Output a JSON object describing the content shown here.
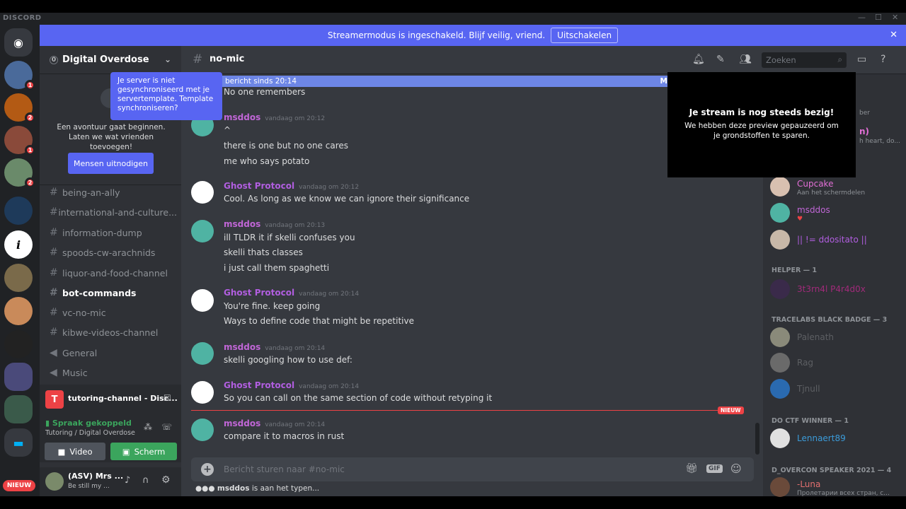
{
  "app": {
    "brand": "DISCORD"
  },
  "banner": {
    "text": "Streamermodus is ingeschakeld. Blijf veilig, vriend.",
    "button": "Uitschakelen"
  },
  "server": {
    "name": "Digital Overdose",
    "boost": "0"
  },
  "rail": {
    "badges": [
      "1",
      "2",
      "1",
      "2"
    ],
    "new_label": "NIEUW"
  },
  "tooltip": "Je server is niet gesynchroniseerd met je servertemplate. Template synchroniseren?",
  "welcome": {
    "line1": "Een avontuur gaat beginnen.",
    "line2": "Laten we wat vrienden toevoegen!",
    "button": "Mensen uitnodigen"
  },
  "channels": [
    {
      "name": "being-an-ally",
      "type": "text"
    },
    {
      "name": "international-and-culture...",
      "type": "text"
    },
    {
      "name": "information-dump",
      "type": "text"
    },
    {
      "name": "spoods-cw-arachnids",
      "type": "text"
    },
    {
      "name": "liquor-and-food-channel",
      "type": "text"
    },
    {
      "name": "bot-commands",
      "type": "text",
      "active": true
    },
    {
      "name": "vc-no-mic",
      "type": "text"
    },
    {
      "name": "kibwe-videos-channel",
      "type": "text"
    },
    {
      "name": "General",
      "type": "voice"
    },
    {
      "name": "Music",
      "type": "voice"
    }
  ],
  "voice": {
    "stream_title": "tutoring-channel - Disc...",
    "status": "Spraak gekoppeld",
    "location": "Tutoring / Digital Overdose",
    "video": "Video",
    "screen": "Scherm"
  },
  "user": {
    "name": "(ASV) Mrs ...",
    "status": "Be still my ..."
  },
  "chat": {
    "channel": "no-mic",
    "search_placeholder": "Zoeken",
    "new_since": "bericht sinds 20:14",
    "new_since_right": "Ma",
    "first_line": "No one remembers",
    "messages": [
      {
        "author": "msddos",
        "color": "#c066d6",
        "time": "vandaag om 20:12",
        "lines": [
          "^",
          "there is one but no one cares",
          "me who says potato"
        ]
      },
      {
        "author": "Ghost Protocol",
        "color": "#b15ee0",
        "time": "vandaag om 20:12",
        "lines": [
          "Cool. As long as we know we can ignore their significance"
        ]
      },
      {
        "author": "msddos",
        "color": "#c066d6",
        "time": "vandaag om 20:13",
        "lines": [
          "ill TLDR it if skelli confuses you",
          "skelli thats classes",
          "i just call them spaghetti"
        ]
      },
      {
        "author": "Ghost Protocol",
        "color": "#b15ee0",
        "time": "vandaag om 20:14",
        "lines": [
          "You're fine. keep going",
          "Ways to define code that might be repetitive"
        ]
      },
      {
        "author": "msddos",
        "color": "#c066d6",
        "time": "vandaag om 20:14",
        "lines": [
          "skelli googling how to use def:"
        ]
      },
      {
        "author": "Ghost Protocol",
        "color": "#b15ee0",
        "time": "vandaag om 20:14",
        "lines": [
          "So you can call on the same section of code without retyping it"
        ]
      },
      {
        "author": "msddos",
        "color": "#c066d6",
        "time": "vandaag om 20:14",
        "lines": [
          "compare it to macros in rust"
        ]
      }
    ],
    "new_tag": "NIEUW",
    "composer_placeholder": "Bericht sturen naar #no-mic",
    "typing_user": "msddos",
    "typing_suffix": "is aan het typen..."
  },
  "stream_overlay": {
    "title": "Je stream is nog steeds bezig!",
    "body": "We hebben deze preview gepauzeerd om je grondstoffen te sparen."
  },
  "members": {
    "peek": [
      "ber",
      "n)",
      "h heart, do..."
    ],
    "online": [
      {
        "name": "Cupcake",
        "sub": "Aan het schermdelen",
        "color": "#e26fd6"
      },
      {
        "name": "msddos",
        "sub": "",
        "color": "#c066d6"
      },
      {
        "name": "|| != ddositato ||",
        "sub": "",
        "color": "#b15ee0"
      }
    ],
    "groups": [
      {
        "title": "HELPER — 1",
        "items": [
          {
            "name": "3t3rn4l P4r4d0x",
            "color": "#a12a7a"
          }
        ]
      },
      {
        "title": "TRACELABS BLACK BADGE — 3",
        "items": [
          {
            "name": "Palenath",
            "color": "#5d5f63"
          },
          {
            "name": "Rag",
            "color": "#5d5f63"
          },
          {
            "name": "Tjnull",
            "color": "#5d5f63"
          }
        ]
      },
      {
        "title": "DO CTF WINNER — 1",
        "items": [
          {
            "name": "Lennaert89",
            "color": "#3b9bd9"
          }
        ]
      },
      {
        "title": "D_OVERCON SPEAKER 2021 — 4",
        "items": [
          {
            "name": "-Luna",
            "sub": "Пролетарии всех стран, с...",
            "color": "#e26f6f"
          }
        ]
      }
    ]
  }
}
